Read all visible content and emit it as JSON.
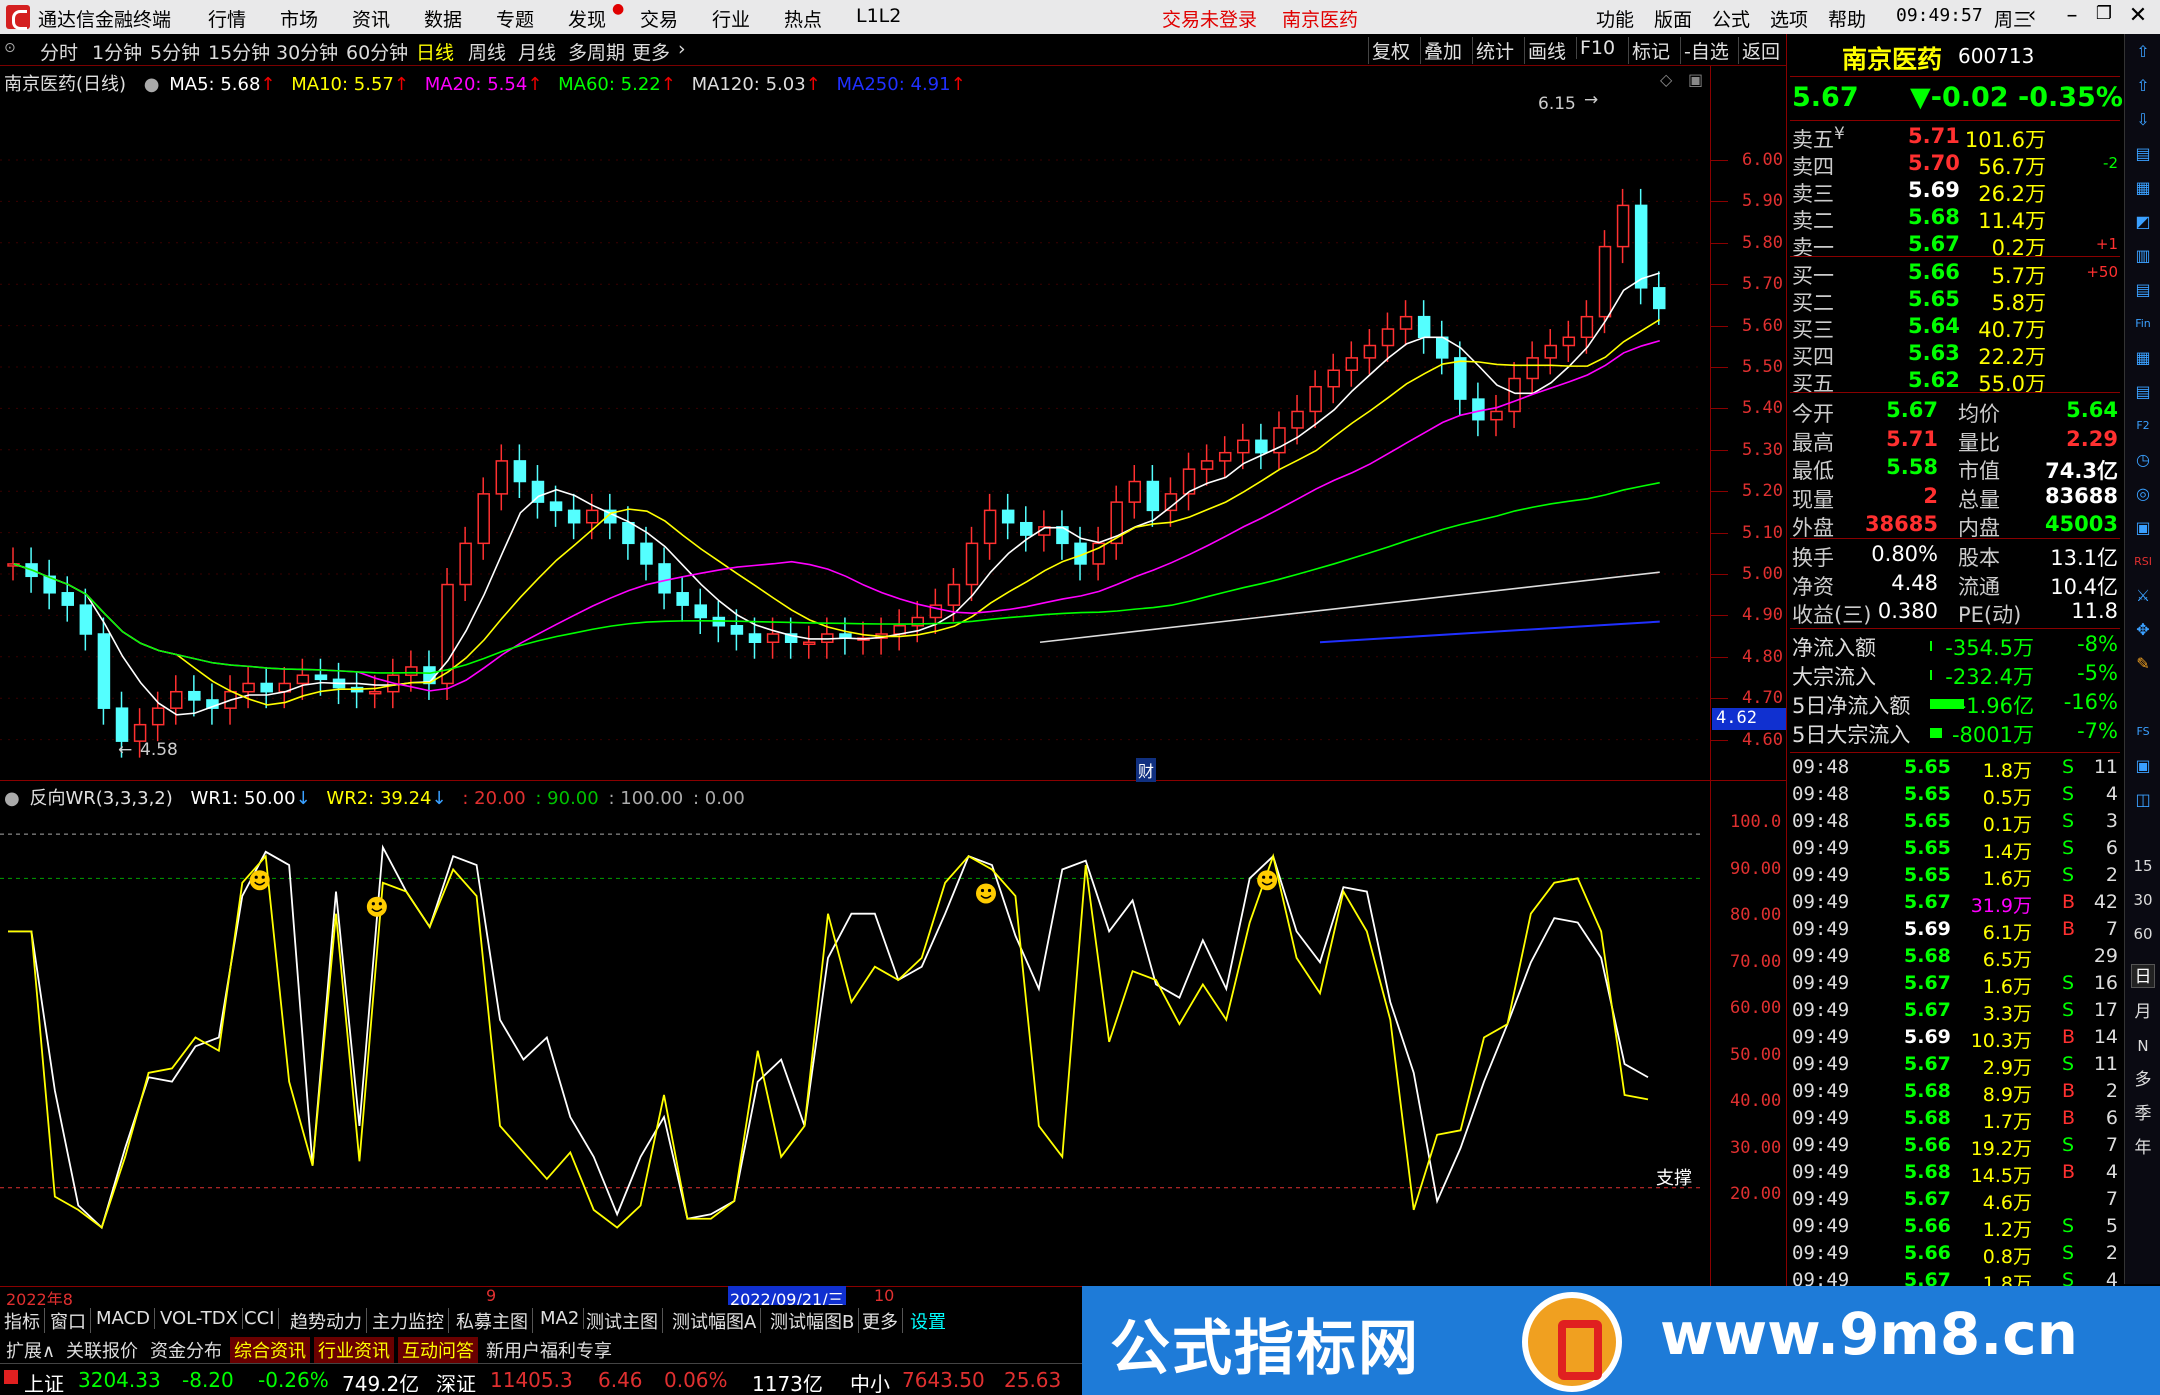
{
  "app": {
    "title": "通达信金融终端",
    "menu": [
      "行情",
      "市场",
      "资讯",
      "数据",
      "专题",
      "发现",
      "交易",
      "行业",
      "热点",
      "L1L2"
    ],
    "status_trade": "交易未登录",
    "stock_title": "南京医药",
    "right_menu": [
      "功能",
      "版面",
      "公式",
      "选项",
      "帮助"
    ],
    "clock": "09:49:57",
    "weekday": "周三"
  },
  "periods": [
    "分时",
    "1分钟",
    "5分钟",
    "15分钟",
    "30分钟",
    "60分钟",
    "日线",
    "周线",
    "月线",
    "多周期",
    "更多"
  ],
  "tools": [
    "复权",
    "叠加",
    "统计",
    "画线",
    "F10",
    "标记",
    "-自选",
    "返回"
  ],
  "main_chart": {
    "label": "南京医药(日线)",
    "ma": [
      {
        "name": "MA5: 5.68",
        "color": "#ffffff"
      },
      {
        "name": "MA10: 5.57",
        "color": "#ffff00"
      },
      {
        "name": "MA20: 5.54",
        "color": "#ff00ff"
      },
      {
        "name": "MA60: 5.22",
        "color": "#00ff00"
      },
      {
        "name": "MA120: 5.03",
        "color": "#dddddd"
      },
      {
        "name": "MA250: 4.91",
        "color": "#2030ff"
      }
    ],
    "high_label": "6.15",
    "low_label": "4.58",
    "price_tag": "4.62",
    "axis": [
      "6.00",
      "5.90",
      "5.80",
      "5.70",
      "5.60",
      "5.50",
      "5.40",
      "5.30",
      "5.20",
      "5.10",
      "5.00",
      "4.90",
      "4.80",
      "4.70",
      "4.60"
    ],
    "fin_mark": "财"
  },
  "chart_data": {
    "type": "line",
    "title": "反向WR(3,3,3,2)",
    "series": [
      {
        "name": "WR1",
        "values": [
          78,
          78,
          42,
          16,
          11,
          29,
          45,
          44,
          52,
          54,
          86,
          96,
          93,
          25,
          87,
          34,
          97,
          87,
          79,
          95,
          93,
          58,
          49,
          54,
          36,
          27,
          14,
          27,
          36,
          13,
          14,
          17,
          44,
          49,
          34,
          72,
          82,
          82,
          67,
          70,
          82,
          95,
          93,
          77,
          65,
          92,
          94,
          78,
          85,
          66,
          63,
          76,
          65,
          90,
          95,
          78,
          71,
          88,
          87,
          62,
          46,
          17,
          29,
          44,
          57,
          71,
          81,
          80,
          72,
          48,
          45
        ]
      },
      {
        "name": "WR2",
        "values": [
          78,
          78,
          18,
          15,
          11,
          27,
          46,
          47,
          54,
          51,
          89,
          95,
          44,
          25,
          82,
          26,
          89,
          87,
          79,
          92,
          86,
          34,
          28,
          22,
          28,
          15,
          11,
          16,
          41,
          13,
          13,
          17,
          51,
          27,
          34,
          82,
          62,
          70,
          67,
          72,
          89,
          95,
          92,
          86,
          34,
          27,
          93,
          53,
          69,
          67,
          57,
          66,
          58,
          80,
          95,
          72,
          64,
          87,
          78,
          58,
          15,
          32,
          33,
          54,
          57,
          82,
          89,
          90,
          78,
          41,
          40
        ]
      }
    ],
    "axis": [
      "100.0",
      "90.00",
      "80.00",
      "70.00",
      "60.00",
      "50.00",
      "40.00",
      "30.00",
      "20.00"
    ],
    "ylim": [
      10,
      105
    ]
  },
  "indicator": {
    "label": "反向WR(3,3,3,2)",
    "wr1": "WR1: 50.00",
    "wr2": "WR2: 39.24",
    "levels": [
      ": 20.00",
      ": 90.00",
      ": 100.00",
      ": 0.00"
    ],
    "support": "支撑"
  },
  "xaxis": {
    "start": "2022年8",
    "mid": "9",
    "cursor": "2022/09/21/三",
    "end": "10"
  },
  "quote": {
    "name": "南京医药",
    "code": "600713",
    "price": "5.67",
    "change": "▼-0.02",
    "pct": "-0.35%",
    "asks": [
      {
        "label": "卖五",
        "mark": "¥",
        "price": "5.71",
        "vol": "101.6万",
        "chg": ""
      },
      {
        "label": "卖四",
        "mark": "",
        "price": "5.70",
        "vol": "56.7万",
        "chg": "-2"
      },
      {
        "label": "卖三",
        "mark": "",
        "price": "5.69",
        "vol": "26.2万",
        "chg": ""
      },
      {
        "label": "卖二",
        "mark": "",
        "price": "5.68",
        "vol": "11.4万",
        "chg": ""
      },
      {
        "label": "卖一",
        "mark": "",
        "price": "5.67",
        "vol": "0.2万",
        "chg": "+1"
      }
    ],
    "bids": [
      {
        "label": "买一",
        "price": "5.66",
        "vol": "5.7万",
        "chg": "+50"
      },
      {
        "label": "买二",
        "price": "5.65",
        "vol": "5.8万",
        "chg": ""
      },
      {
        "label": "买三",
        "price": "5.64",
        "vol": "40.7万",
        "chg": ""
      },
      {
        "label": "买四",
        "price": "5.63",
        "vol": "22.2万",
        "chg": ""
      },
      {
        "label": "买五",
        "price": "5.62",
        "vol": "55.0万",
        "chg": ""
      }
    ],
    "stats": [
      {
        "k1": "今开",
        "v1": "5.67",
        "k2": "均价",
        "v2": "5.64"
      },
      {
        "k1": "最高",
        "v1": "5.71",
        "k2": "量比",
        "v2": "2.29"
      },
      {
        "k1": "最低",
        "v1": "5.58",
        "k2": "市值",
        "v2": "74.3亿"
      },
      {
        "k1": "现量",
        "v1": "2",
        "k2": "总量",
        "v2": "83688"
      },
      {
        "k1": "外盘",
        "v1": "38685",
        "k2": "内盘",
        "v2": "45003"
      }
    ],
    "stats2": [
      {
        "k1": "换手",
        "v1": "0.80%",
        "k2": "股本",
        "v2": "13.1亿"
      },
      {
        "k1": "净资",
        "v1": "4.48",
        "k2": "流通",
        "v2": "10.4亿"
      },
      {
        "k1": "收益(三)",
        "v1": "0.380",
        "k2": "PE(动)",
        "v2": "11.8"
      }
    ],
    "flows": [
      {
        "k": "净流入额",
        "v": "-354.5万",
        "p": "-8%"
      },
      {
        "k": "大宗流入",
        "v": "-232.4万",
        "p": "-5%"
      },
      {
        "k": "5日净流入额",
        "v": "-1.96亿",
        "p": "-16%"
      },
      {
        "k": "5日大宗流入",
        "v": "-8001万",
        "p": "-7%"
      }
    ],
    "ticks": [
      {
        "t": "09:48",
        "p": "5.65",
        "v": "1.8万",
        "s": "S",
        "n": "11"
      },
      {
        "t": "09:48",
        "p": "5.65",
        "v": "0.5万",
        "s": "S",
        "n": "4"
      },
      {
        "t": "09:48",
        "p": "5.65",
        "v": "0.1万",
        "s": "S",
        "n": "3"
      },
      {
        "t": "09:49",
        "p": "5.65",
        "v": "1.4万",
        "s": "S",
        "n": "6"
      },
      {
        "t": "09:49",
        "p": "5.65",
        "v": "1.6万",
        "s": "S",
        "n": "2"
      },
      {
        "t": "09:49",
        "p": "5.67",
        "v": "31.9万",
        "s": "B",
        "n": "42"
      },
      {
        "t": "09:49",
        "p": "5.69",
        "v": "6.1万",
        "s": "B",
        "n": "7"
      },
      {
        "t": "09:49",
        "p": "5.68",
        "v": "6.5万",
        "s": "",
        "n": "29"
      },
      {
        "t": "09:49",
        "p": "5.67",
        "v": "1.6万",
        "s": "S",
        "n": "16"
      },
      {
        "t": "09:49",
        "p": "5.67",
        "v": "3.3万",
        "s": "S",
        "n": "17"
      },
      {
        "t": "09:49",
        "p": "5.69",
        "v": "10.3万",
        "s": "B",
        "n": "14"
      },
      {
        "t": "09:49",
        "p": "5.67",
        "v": "2.9万",
        "s": "S",
        "n": "11"
      },
      {
        "t": "09:49",
        "p": "5.68",
        "v": "8.9万",
        "s": "B",
        "n": "2"
      },
      {
        "t": "09:49",
        "p": "5.68",
        "v": "1.7万",
        "s": "B",
        "n": "6"
      },
      {
        "t": "09:49",
        "p": "5.66",
        "v": "19.2万",
        "s": "S",
        "n": "7"
      },
      {
        "t": "09:49",
        "p": "5.68",
        "v": "14.5万",
        "s": "B",
        "n": "4"
      },
      {
        "t": "09:49",
        "p": "5.67",
        "v": "4.6万",
        "s": "",
        "n": "7"
      },
      {
        "t": "09:49",
        "p": "5.66",
        "v": "1.2万",
        "s": "S",
        "n": "5"
      },
      {
        "t": "09:49",
        "p": "5.66",
        "v": "0.8万",
        "s": "S",
        "n": "2"
      },
      {
        "t": "09:49",
        "p": "5.67",
        "v": "1.8万",
        "s": "S",
        "n": "4"
      }
    ]
  },
  "side_icons": [
    "15",
    "30",
    "60",
    "日",
    "月",
    "N",
    "多",
    "季",
    "年"
  ],
  "tabs1": [
    "指标",
    "窗口",
    "MACD",
    "VOL-TDX",
    "CCI",
    "趋势动力",
    "主力监控",
    "私募主图",
    "MA2",
    "测试主图",
    "测试幅图A",
    "测试幅图B",
    "更多",
    "设置"
  ],
  "tabs2": [
    "扩展∧",
    "关联报价",
    "资金分布",
    "综合资讯",
    "行业资讯",
    "互动问答",
    "新用户福利专享"
  ],
  "status": {
    "sh": "上证",
    "sh_val": "3204.33",
    "sh_chg": "-8.20",
    "sh_pct": "-0.26%",
    "sh_amt": "749.2亿",
    "sz": "深证",
    "sz_val": "11405.3",
    "sz_chg": "6.46",
    "sz_pct": "0.06%",
    "sz_amt": "1173亿",
    "zx": "中小",
    "zx_val": "7643.50",
    "zx_chg": "25.63"
  },
  "banner": {
    "left": "公式指标网",
    "right": "www.9m8.cn"
  }
}
